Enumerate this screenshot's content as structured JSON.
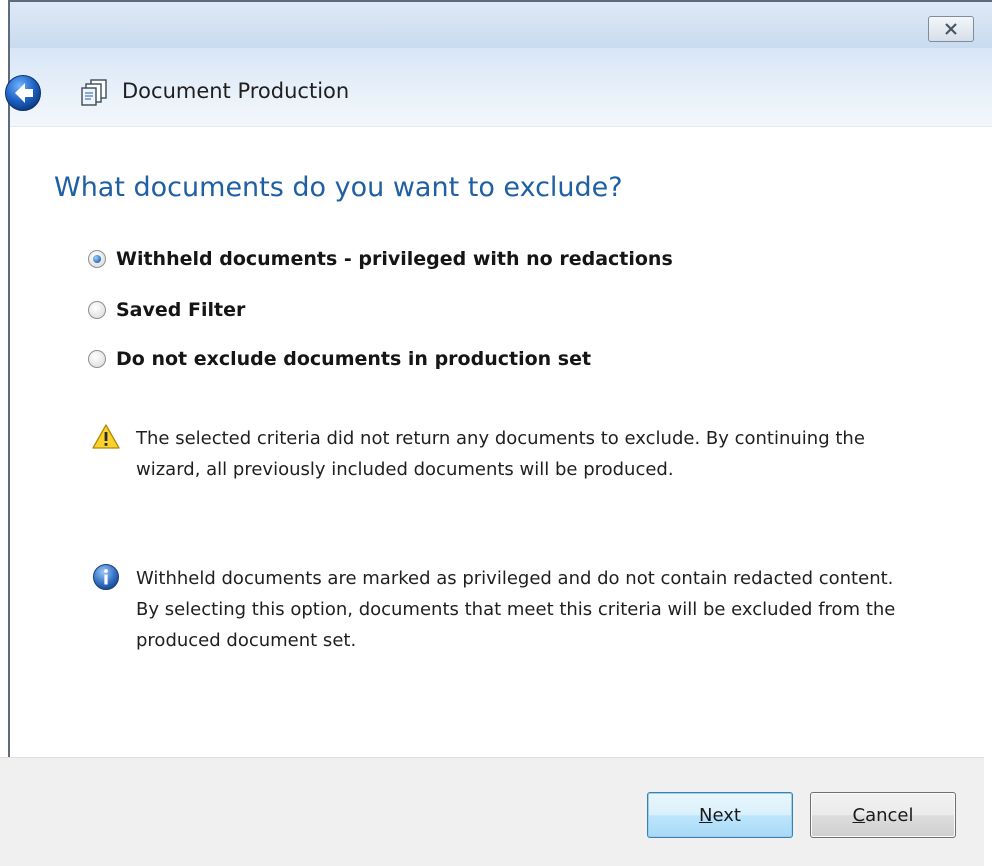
{
  "window": {
    "close_icon": "close-icon"
  },
  "header": {
    "title": "Document Production",
    "back_icon": "back-arrow-icon",
    "app_icon": "document-production-icon"
  },
  "main": {
    "heading": "What documents do you want to exclude?",
    "options": [
      {
        "label": "Withheld documents - privileged with no redactions",
        "checked": true
      },
      {
        "label": "Saved Filter",
        "checked": false
      },
      {
        "label": "Do not exclude documents in production set",
        "checked": false
      }
    ],
    "warning": {
      "icon": "warning-icon",
      "text": "The selected criteria did not return any documents to exclude. By continuing the wizard, all previously included documents will be produced."
    },
    "info": {
      "icon": "info-icon",
      "text": "Withheld documents are marked as privileged and do not contain redacted content. By selecting this option, documents that meet this criteria will be excluded from the produced document set."
    }
  },
  "footer": {
    "next_mnemonic": "N",
    "next_rest": "ext",
    "cancel_mnemonic": "C",
    "cancel_rest": "ancel"
  },
  "colors": {
    "heading": "#1f5fa3",
    "header_bg": "#dce8f6",
    "footer_bg": "#f0f0f0"
  }
}
